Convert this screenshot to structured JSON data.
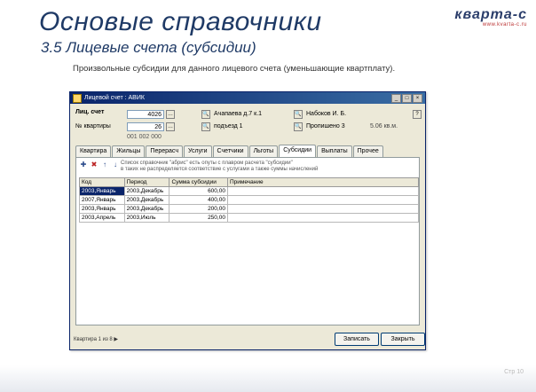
{
  "slide": {
    "title": "Основые справочники",
    "subtitle": "3.5  Лицевые счета (субсидии)",
    "description": "Произвольные субсидии для данного лицевого счета (уменьшающие квартплату).",
    "brand": "кварта-с",
    "brand_url": "www.kvarta-c.ru",
    "slide_number": "Стр 10"
  },
  "window": {
    "title": "Лицевой счет : АВИК",
    "controls": [
      "_",
      "□",
      "×"
    ],
    "account_label": "Лиц. счет",
    "account_value": "4026",
    "kv_label": "№ квартиры",
    "kv_value": "26",
    "address1": "Ачапаева д.7 к.1",
    "address2": "подъезд 1",
    "code": "001 002 000",
    "owner": "Набоков И. Б.",
    "owner2": "Пропишено 3",
    "meta": "5.06 кв.м.",
    "help": "?"
  },
  "tabs": [
    "Квартира",
    "Жильцы",
    "Перерасч",
    "Услуги",
    "Счетчики",
    "Льготы",
    "Субсидии",
    "Выплаты",
    "Прочее"
  ],
  "active_tab": "Субсидии",
  "panel": {
    "info_line1": "Список справочник \"абрис\" есть опуты с плавром расчета \"субсидии\"",
    "info_line2": "в таких не распределяется соответствие с услугами а также суммы начислений"
  },
  "grid": {
    "columns": [
      "Код",
      "Период",
      "Сумма субсидии",
      "Примечание"
    ],
    "rows": [
      {
        "code": "2003,Январь",
        "period": "2003,Декабрь",
        "amount": "600,00",
        "note": ""
      },
      {
        "code": "2007,Январь",
        "period": "2003,Декабрь",
        "amount": "400,00",
        "note": ""
      },
      {
        "code": "2003,Январь",
        "period": "2003,Декабрь",
        "amount": "200,00",
        "note": ""
      },
      {
        "code": "2003,Апрель",
        "period": "2003,Июль",
        "amount": "250,00",
        "note": ""
      }
    ]
  },
  "footer": {
    "status": "Квартира 1 из 8 ▶",
    "save_label": "Записать",
    "close_label": "Закрыть"
  }
}
